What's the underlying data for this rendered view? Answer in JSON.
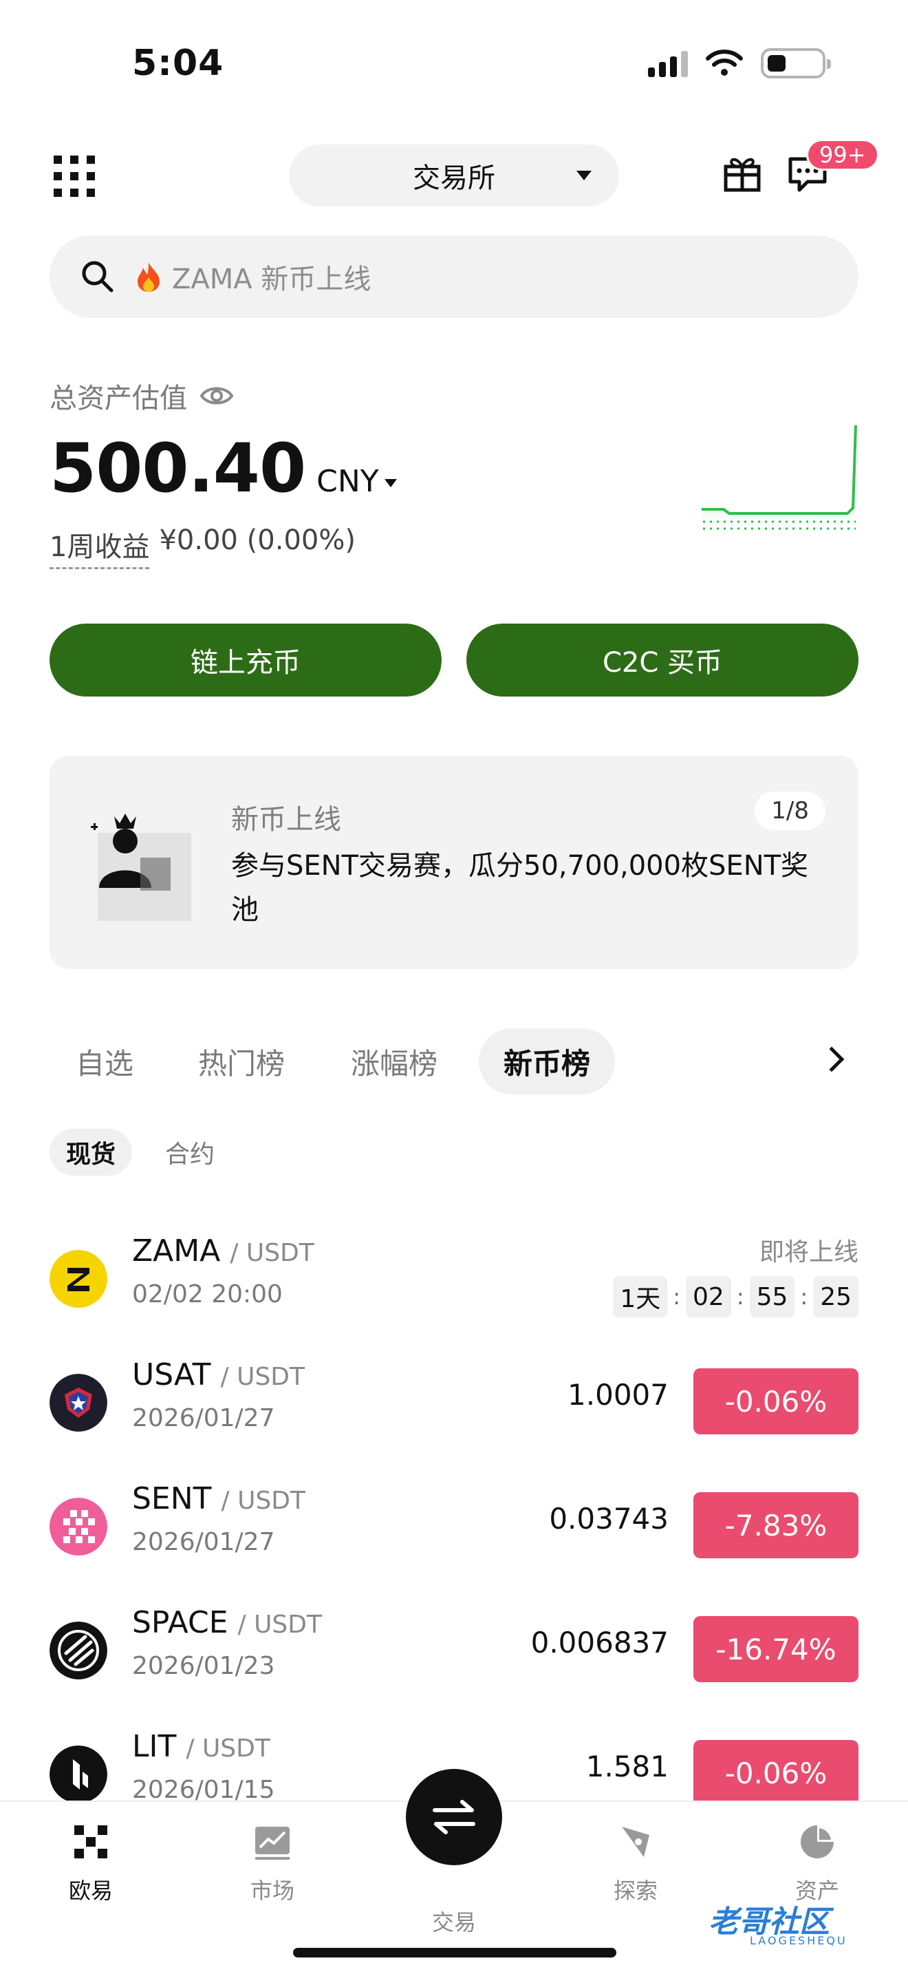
{
  "status_bar": {
    "time": "5:04"
  },
  "header": {
    "exchange_label": "交易所",
    "message_badge": "99+"
  },
  "search": {
    "placeholder": "ZAMA 新币上线"
  },
  "assets": {
    "label": "总资产估值",
    "amount": "500.40",
    "currency": "CNY",
    "weekly_label": "1周收益",
    "weekly_value": "¥0.00 (0.00%)"
  },
  "actions": {
    "deposit_label": "链上充币",
    "c2c_label": "C2C 买币"
  },
  "promo": {
    "title": "新币上线",
    "body": "参与SENT交易赛，瓜分50,700,000枚SENT奖池",
    "pager": "1/8"
  },
  "tabs": [
    "自选",
    "热门榜",
    "涨幅榜",
    "新币榜"
  ],
  "subtabs": [
    "现货",
    "合约"
  ],
  "coins": [
    {
      "symbol": "ZAMA",
      "quote": "/ USDT",
      "date": "02/02 20:00",
      "status": "即将上线",
      "countdown": [
        "1天",
        "02",
        "55",
        "25"
      ],
      "color": "#f5d400"
    },
    {
      "symbol": "USAT",
      "quote": "/ USDT",
      "date": "2026/01/27",
      "price": "1.0007",
      "change": "-0.06%",
      "color": "#1d1d2b"
    },
    {
      "symbol": "SENT",
      "quote": "/ USDT",
      "date": "2026/01/27",
      "price": "0.03743",
      "change": "-7.83%",
      "color": "#f05e9a"
    },
    {
      "symbol": "SPACE",
      "quote": "/ USDT",
      "date": "2026/01/23",
      "price": "0.006837",
      "change": "-16.74%",
      "color": "#111111"
    },
    {
      "symbol": "LIT",
      "quote": "/ USDT",
      "date": "2026/01/15",
      "price": "1.581",
      "change": "-0.06%",
      "color": "#111111"
    }
  ],
  "bottom_nav": {
    "home": "欧易",
    "market": "市场",
    "trade": "交易",
    "explore": "探索",
    "assets": "资产"
  },
  "watermark": {
    "text": "老哥社区",
    "sub": "LAOGESHEQU"
  },
  "colors": {
    "brand_green": "#2d6c17",
    "down_red": "#e94c6e",
    "badge_red": "#f04a6c"
  },
  "icons": [
    "grid-menu-icon",
    "gift-icon",
    "message-icon",
    "search-icon",
    "fire-icon",
    "eye-icon",
    "chevron-right-icon",
    "swap-icon",
    "market-icon",
    "explore-icon",
    "assets-pie-icon",
    "okx-logo-icon"
  ]
}
